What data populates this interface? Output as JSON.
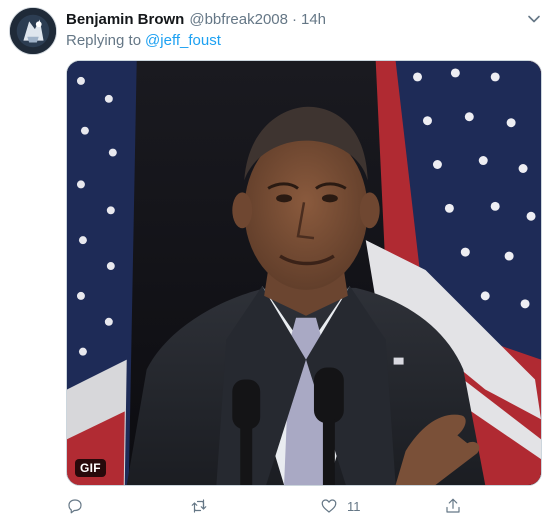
{
  "tweet": {
    "display_name": "Benjamin Brown",
    "handle": "@bbfreak2008",
    "separator": "·",
    "time": "14h",
    "replying_prefix": "Replying to",
    "replying_handle": "@jeff_foust"
  },
  "media": {
    "badge": "GIF",
    "content": "animated GIF of a man in a dark suit and lavender tie shrugging in front of American flags"
  },
  "actions": {
    "reply_icon": "reply-icon",
    "retweet_icon": "retweet-icon",
    "like_icon": "heart-icon",
    "like_count": "11",
    "share_icon": "share-icon"
  },
  "colors": {
    "link": "#1da1f2",
    "secondary_text": "#657786",
    "primary_text": "#14171a"
  }
}
